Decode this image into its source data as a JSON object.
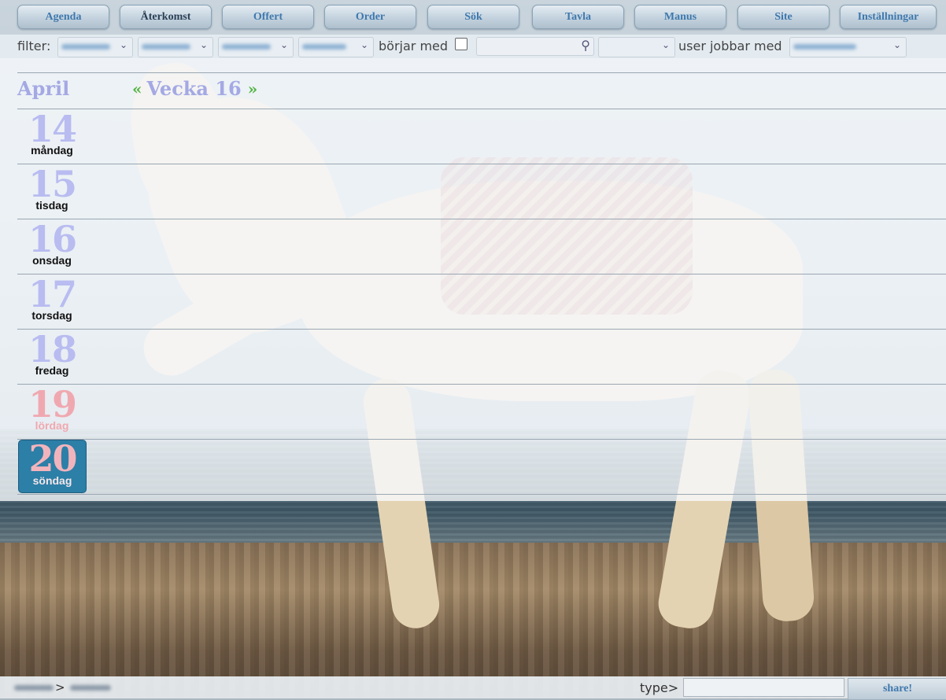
{
  "nav": {
    "items": [
      {
        "label": "Agenda"
      },
      {
        "label": "Återkomst"
      },
      {
        "label": "Offert"
      },
      {
        "label": "Order"
      },
      {
        "label": "Sök"
      },
      {
        "label": "Tavla"
      },
      {
        "label": "Manus"
      },
      {
        "label": "Site"
      },
      {
        "label": "Inställningar"
      }
    ]
  },
  "filter": {
    "label": "filter:",
    "begins_with_label": "börjar med",
    "begins_with_checked": false,
    "search_value": "",
    "user_works_with_label": "user jobbar med"
  },
  "calendar": {
    "month": "April",
    "week_label": "Vecka 16",
    "prev_glyph": "«",
    "next_glyph": "»",
    "days": [
      {
        "num": "14",
        "name": "måndag",
        "weekend": false,
        "today": false
      },
      {
        "num": "15",
        "name": "tisdag",
        "weekend": false,
        "today": false
      },
      {
        "num": "16",
        "name": "onsdag",
        "weekend": false,
        "today": false
      },
      {
        "num": "17",
        "name": "torsdag",
        "weekend": false,
        "today": false
      },
      {
        "num": "18",
        "name": "fredag",
        "weekend": false,
        "today": false
      },
      {
        "num": "19",
        "name": "lördag",
        "weekend": true,
        "today": false
      },
      {
        "num": "20",
        "name": "söndag",
        "weekend": true,
        "today": true
      }
    ]
  },
  "bottom": {
    "crumb_sep": ">",
    "type_label": "type>",
    "type_value": "",
    "share_label": "share!"
  },
  "colors": {
    "accent": "#3f78ad",
    "weekday_number": "#b8bcf0",
    "weekend_number": "#f0a8b0",
    "today_background": "#2c7fa7",
    "week_arrows": "#52b443"
  }
}
